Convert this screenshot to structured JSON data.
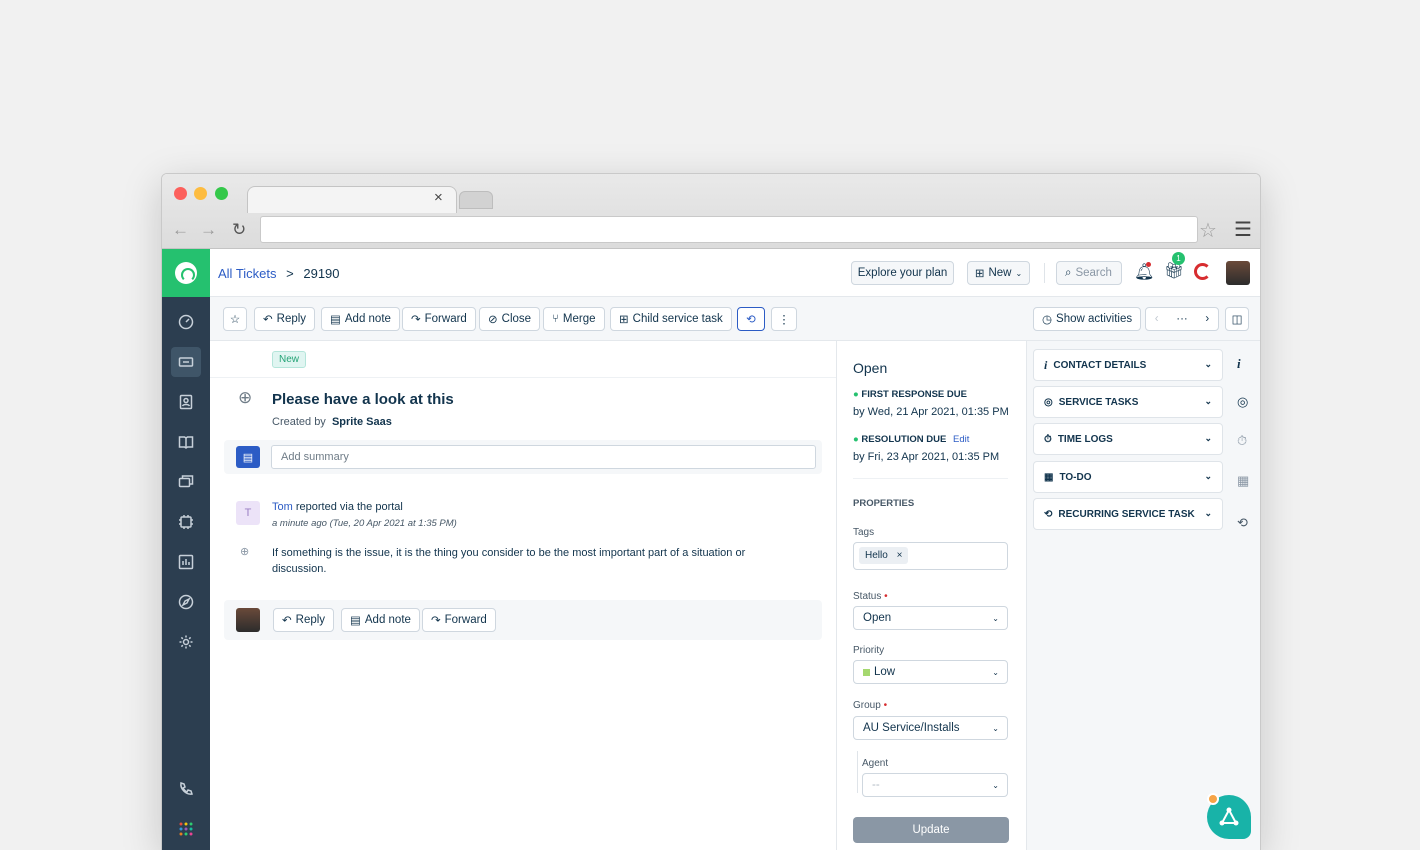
{
  "browser": {
    "tab_close": "×"
  },
  "header": {
    "breadcrumb_link": "All Tickets",
    "breadcrumb_sep": ">",
    "ticket_id": "29190",
    "explore_plan": "Explore your plan",
    "new_label": "New",
    "search_placeholder": "Search",
    "gift_count": "1"
  },
  "toolbar": {
    "reply": "Reply",
    "add_note": "Add note",
    "forward": "Forward",
    "close": "Close",
    "merge": "Merge",
    "child_task": "Child service task",
    "show_activities": "Show activities"
  },
  "ticket": {
    "status_badge": "New",
    "subject": "Please have a look at this",
    "created_by_label": "Created by",
    "created_by": "Sprite Saas",
    "summary_placeholder": "Add summary",
    "message": {
      "avatar_letter": "T",
      "author": "Tom",
      "via": "reported via the portal",
      "time": "a minute ago (Tue, 20 Apr 2021 at 1:35 PM)",
      "body": "If something is the issue, it is the thing you consider to be the most important part of a situation or discussion."
    },
    "reply_bar": {
      "reply": "Reply",
      "add_note": "Add note",
      "forward": "Forward"
    }
  },
  "props": {
    "state": "Open",
    "first_response_label": "FIRST RESPONSE DUE",
    "first_response_date": "by Wed, 21 Apr 2021, 01:35 PM",
    "resolution_label": "RESOLUTION DUE",
    "resolution_edit": "Edit",
    "resolution_date": "by Fri, 23 Apr 2021, 01:35 PM",
    "section_title": "PROPERTIES",
    "tags_label": "Tags",
    "tag": "Hello",
    "status_label": "Status",
    "status_value": "Open",
    "priority_label": "Priority",
    "priority_value": "Low",
    "group_label": "Group",
    "group_value": "AU Service/Installs",
    "agent_label": "Agent",
    "agent_value": "--",
    "update": "Update"
  },
  "widgets": [
    "CONTACT DETAILS",
    "SERVICE TASKS",
    "TIME LOGS",
    "TO-DO",
    "RECURRING SERVICE TASK"
  ],
  "colors": {
    "accent": "#2c5cc5",
    "sidebar": "#2c3e50",
    "brand": "#25c16f"
  }
}
